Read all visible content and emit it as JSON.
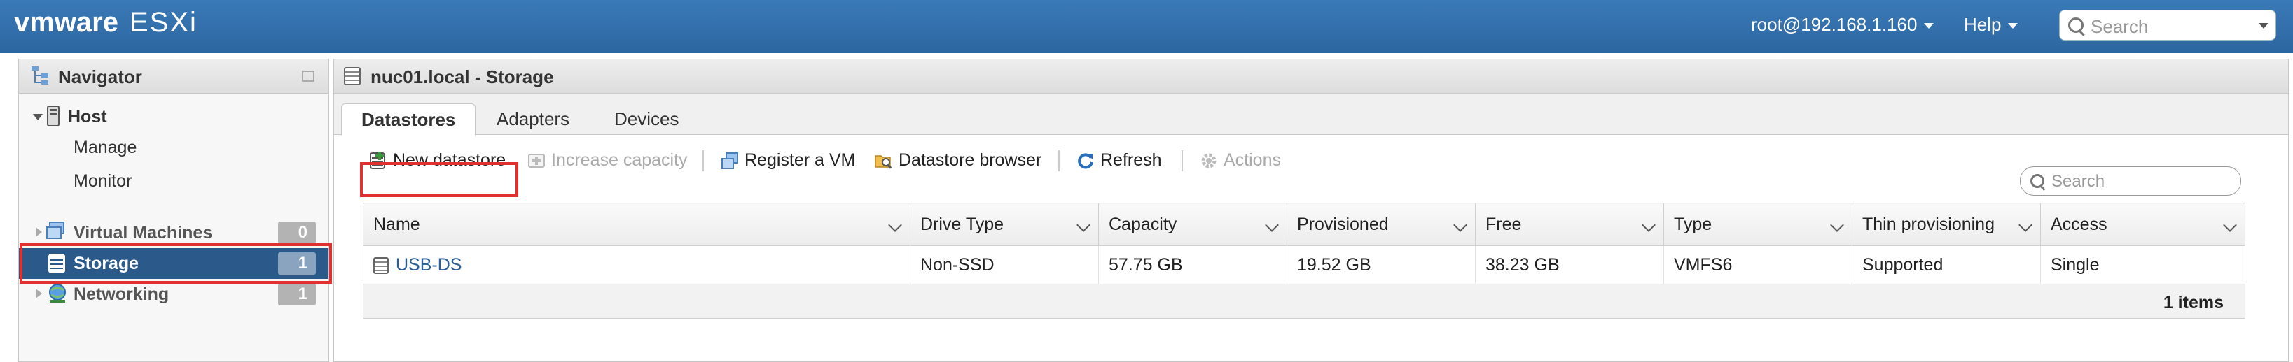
{
  "app": {
    "brand": "vmware",
    "product": "ESXi"
  },
  "topbar": {
    "user": "root@192.168.1.160",
    "help": "Help",
    "search_placeholder": "Search"
  },
  "navigator": {
    "title": "Navigator",
    "host": {
      "label": "Host",
      "children": [
        "Manage",
        "Monitor"
      ]
    },
    "items": [
      {
        "label": "Virtual Machines",
        "count": "0",
        "icon": "virtual-machines-icon"
      },
      {
        "label": "Storage",
        "count": "1",
        "icon": "storage-icon",
        "selected": true
      },
      {
        "label": "Networking",
        "count": "1",
        "icon": "networking-icon"
      }
    ]
  },
  "main": {
    "title": "nuc01.local - Storage",
    "tabs": [
      "Datastores",
      "Adapters",
      "Devices"
    ],
    "active_tab": "Datastores",
    "toolbar": {
      "new_datastore": "New datastore",
      "increase_capacity": "Increase capacity",
      "register_vm": "Register a VM",
      "datastore_browser": "Datastore browser",
      "refresh": "Refresh",
      "actions": "Actions"
    },
    "search_placeholder": "Search",
    "table": {
      "columns": [
        "Name",
        "Drive Type",
        "Capacity",
        "Provisioned",
        "Free",
        "Type",
        "Thin provisioning",
        "Access"
      ],
      "rows": [
        [
          "USB-DS",
          "Non-SSD",
          "57.75 GB",
          "19.52 GB",
          "38.23 GB",
          "VMFS6",
          "Supported",
          "Single"
        ]
      ]
    },
    "item_count": "1 items"
  },
  "colors": {
    "topbar": "#2c66a0",
    "selected": "#2b5a8a",
    "highlight": "#e03030",
    "link": "#2a5d95"
  }
}
